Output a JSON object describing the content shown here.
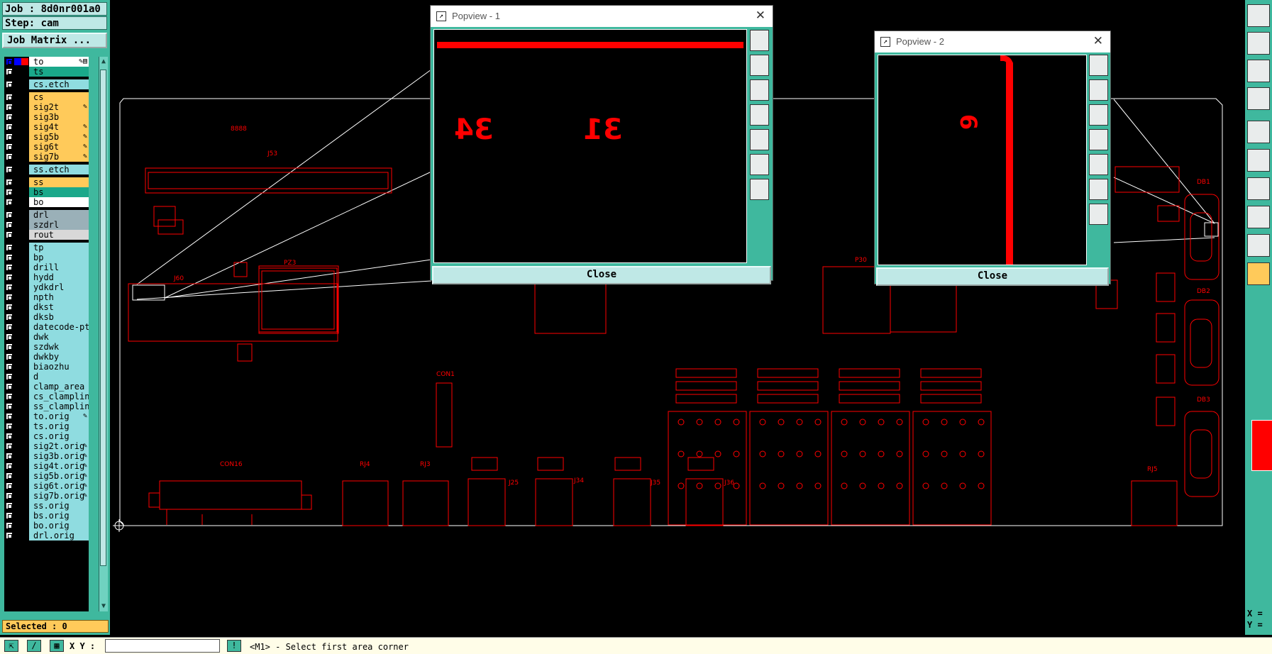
{
  "job": {
    "label": "Job : 8d0nr001a0",
    "step": "Step: cam",
    "matrix_button": "Job Matrix ..."
  },
  "layers": [
    {
      "name": "to",
      "color": "#ffffff",
      "mark": "✎▤",
      "boxes": [
        "#0000ff",
        "#ff0000"
      ]
    },
    {
      "name": "ts",
      "color": "#1aa88a",
      "mark": ""
    },
    {
      "name": "cs.etch",
      "color": "#8fdce0",
      "mark": "",
      "gap": true
    },
    {
      "name": "cs",
      "color": "#ffca5a",
      "mark": "",
      "gap": true
    },
    {
      "name": "sig2t",
      "color": "#ffca5a",
      "mark": "✎"
    },
    {
      "name": "sig3b",
      "color": "#ffca5a",
      "mark": ""
    },
    {
      "name": "sig4t",
      "color": "#ffca5a",
      "mark": "✎"
    },
    {
      "name": "sig5b",
      "color": "#ffca5a",
      "mark": "✎"
    },
    {
      "name": "sig6t",
      "color": "#ffca5a",
      "mark": "✎"
    },
    {
      "name": "sig7b",
      "color": "#ffca5a",
      "mark": "✎"
    },
    {
      "name": "ss.etch",
      "color": "#8fdce0",
      "mark": "",
      "gap": true
    },
    {
      "name": "ss",
      "color": "#ffca5a",
      "mark": "",
      "gap": true
    },
    {
      "name": "bs",
      "color": "#1aa88a",
      "mark": ""
    },
    {
      "name": "bo",
      "color": "#ffffff",
      "mark": ""
    },
    {
      "name": "drl",
      "color": "#9ab0b8",
      "mark": "",
      "gap": true
    },
    {
      "name": "szdrl",
      "color": "#9ab0b8",
      "mark": ""
    },
    {
      "name": "rout",
      "color": "#d8d8d8",
      "mark": ""
    },
    {
      "name": "tp",
      "color": "#8fdce0",
      "mark": "",
      "gap": true
    },
    {
      "name": "bp",
      "color": "#8fdce0",
      "mark": ""
    },
    {
      "name": "drill",
      "color": "#8fdce0",
      "mark": ""
    },
    {
      "name": "hydd",
      "color": "#8fdce0",
      "mark": ""
    },
    {
      "name": "ydkdrl",
      "color": "#8fdce0",
      "mark": ""
    },
    {
      "name": "npth",
      "color": "#8fdce0",
      "mark": ""
    },
    {
      "name": "dkst",
      "color": "#8fdce0",
      "mark": ""
    },
    {
      "name": "dksb",
      "color": "#8fdce0",
      "mark": ""
    },
    {
      "name": "datecode-pt",
      "color": "#8fdce0",
      "mark": ""
    },
    {
      "name": "dwk",
      "color": "#8fdce0",
      "mark": ""
    },
    {
      "name": "szdwk",
      "color": "#8fdce0",
      "mark": ""
    },
    {
      "name": "dwkby",
      "color": "#8fdce0",
      "mark": ""
    },
    {
      "name": "biaozhu",
      "color": "#8fdce0",
      "mark": ""
    },
    {
      "name": "d",
      "color": "#8fdce0",
      "mark": ""
    },
    {
      "name": "clamp_area",
      "color": "#8fdce0",
      "mark": ""
    },
    {
      "name": "cs_clampline",
      "color": "#8fdce0",
      "mark": ""
    },
    {
      "name": "ss_clampline",
      "color": "#8fdce0",
      "mark": ""
    },
    {
      "name": "to.orig",
      "color": "#8fdce0",
      "mark": "✎"
    },
    {
      "name": "ts.orig",
      "color": "#8fdce0",
      "mark": ""
    },
    {
      "name": "cs.orig",
      "color": "#8fdce0",
      "mark": ""
    },
    {
      "name": "sig2t.orig",
      "color": "#8fdce0",
      "mark": "✎"
    },
    {
      "name": "sig3b.orig",
      "color": "#8fdce0",
      "mark": "✎"
    },
    {
      "name": "sig4t.orig",
      "color": "#8fdce0",
      "mark": "✎"
    },
    {
      "name": "sig5b.orig",
      "color": "#8fdce0",
      "mark": "✎"
    },
    {
      "name": "sig6t.orig",
      "color": "#8fdce0",
      "mark": "✎"
    },
    {
      "name": "sig7b.orig",
      "color": "#8fdce0",
      "mark": "✎"
    },
    {
      "name": "ss.orig",
      "color": "#8fdce0",
      "mark": ""
    },
    {
      "name": "bs.orig",
      "color": "#8fdce0",
      "mark": ""
    },
    {
      "name": "bo.orig",
      "color": "#8fdce0",
      "mark": ""
    },
    {
      "name": "drl.orig",
      "color": "#8fdce0",
      "mark": ""
    }
  ],
  "selected": "Selected : 0",
  "bottom": {
    "xy_label": "X Y :",
    "xy_value": "",
    "status": "<M1> - Select first area corner",
    "info_icon": "!"
  },
  "coords": {
    "x": "X =",
    "y": "Y ="
  },
  "popup1": {
    "title": "Popview - 1",
    "close": "Close",
    "glyph_a": "34",
    "glyph_b": "31"
  },
  "popup2": {
    "title": "Popview - 2",
    "close": "Close",
    "glyph_a": "6"
  },
  "board_labels": {
    "p1": "8888",
    "p2": "J53",
    "p3": "PZ3",
    "p4": "J60",
    "p5": "CON1",
    "p6": "CON16",
    "p7": "RJ4",
    "p8": "RJ3",
    "p9": "J25",
    "p10": "J34",
    "p11": "J35",
    "p12": "J36",
    "p13": "P30",
    "p14": "DB1",
    "p15": "DB2",
    "p16": "DB3",
    "p17": "RJ5"
  },
  "colors": {
    "trace": "#ff0000",
    "panel": "#3fb89e",
    "outline": "#ffffff"
  }
}
